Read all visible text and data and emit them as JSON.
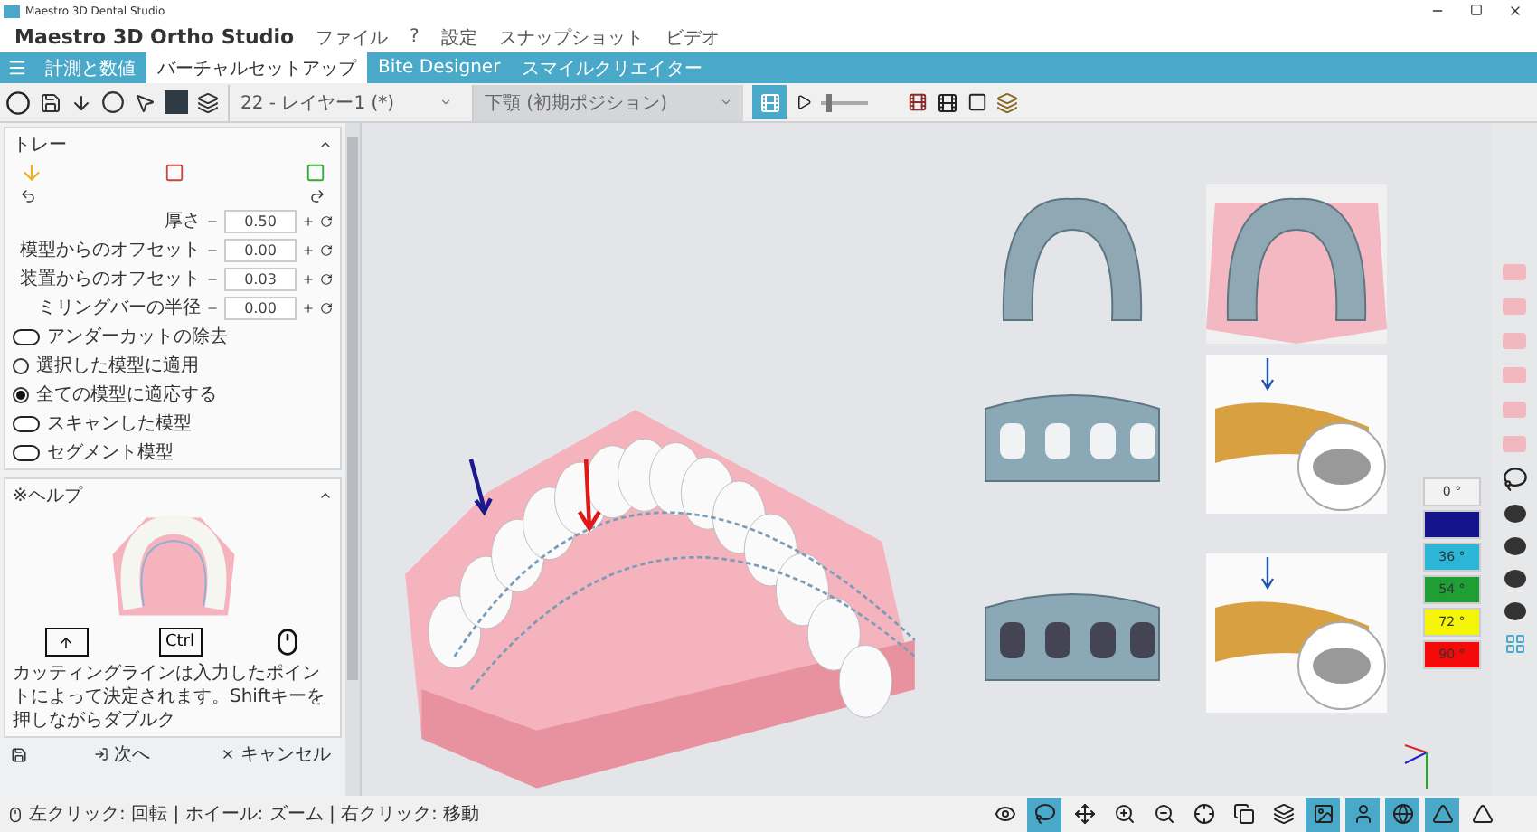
{
  "window": {
    "title": "Maestro 3D Dental Studio"
  },
  "app_title": "Maestro 3D Ortho Studio",
  "menu": [
    "ファイル",
    "?",
    "設定",
    "スナップショット",
    "ビデオ"
  ],
  "tabs": [
    {
      "label": "計測と数値",
      "selected": false
    },
    {
      "label": "バーチャルセットアップ",
      "selected": true
    },
    {
      "label": "Bite Designer",
      "selected": false
    },
    {
      "label": "スマイルクリエイター",
      "selected": false
    }
  ],
  "toolbar": {
    "layer_select": "22 - レイヤー1 (*)",
    "jaw_select": "下顎 (初期ポジション)"
  },
  "tray_panel": {
    "title": "トレー",
    "params": [
      {
        "label": "厚さ",
        "value": "0.50"
      },
      {
        "label": "模型からのオフセット",
        "value": "0.00"
      },
      {
        "label": "装置からのオフセット",
        "value": "0.03"
      },
      {
        "label": "ミリングバーの半径",
        "value": "0.00"
      }
    ],
    "options": [
      {
        "kind": "toggle",
        "label": "アンダーカットの除去",
        "on": false
      },
      {
        "kind": "radio",
        "label": "選択した模型に適用",
        "selected": false
      },
      {
        "kind": "radio",
        "label": "全ての模型に適応する",
        "selected": true
      },
      {
        "kind": "toggle",
        "label": "スキャンした模型",
        "on": false
      },
      {
        "kind": "toggle",
        "label": "セグメント模型",
        "on": false
      }
    ]
  },
  "help_panel": {
    "title": "※ヘルプ",
    "keys": [
      "Ctrl"
    ],
    "text": "カッティングラインは入力したポイントによって決定されます。Shiftキーを押しながらダブルク"
  },
  "footer": {
    "next": "次へ",
    "cancel": "キャンセル"
  },
  "legend": [
    {
      "label": "0 °",
      "color": "#f2f2f2"
    },
    {
      "color": "#14148c"
    },
    {
      "label": "36 °",
      "color": "#2bb5d6"
    },
    {
      "label": "54 °",
      "color": "#1f9e35"
    },
    {
      "label": "72 °",
      "color": "#f5f50a"
    },
    {
      "label": "90 °",
      "color": "#f50a0a"
    }
  ],
  "bottom_tools": [
    {
      "on": false
    },
    {
      "on": true
    },
    {
      "on": false
    },
    {
      "on": false
    },
    {
      "on": false
    },
    {
      "on": false
    },
    {
      "on": false
    },
    {
      "on": false
    },
    {
      "on": true
    },
    {
      "on": true
    },
    {
      "on": true
    },
    {
      "on": true
    },
    {
      "on": false
    }
  ],
  "status_bar": "左クリック: 回転 | ホイール: ズーム | 右クリック: 移動"
}
